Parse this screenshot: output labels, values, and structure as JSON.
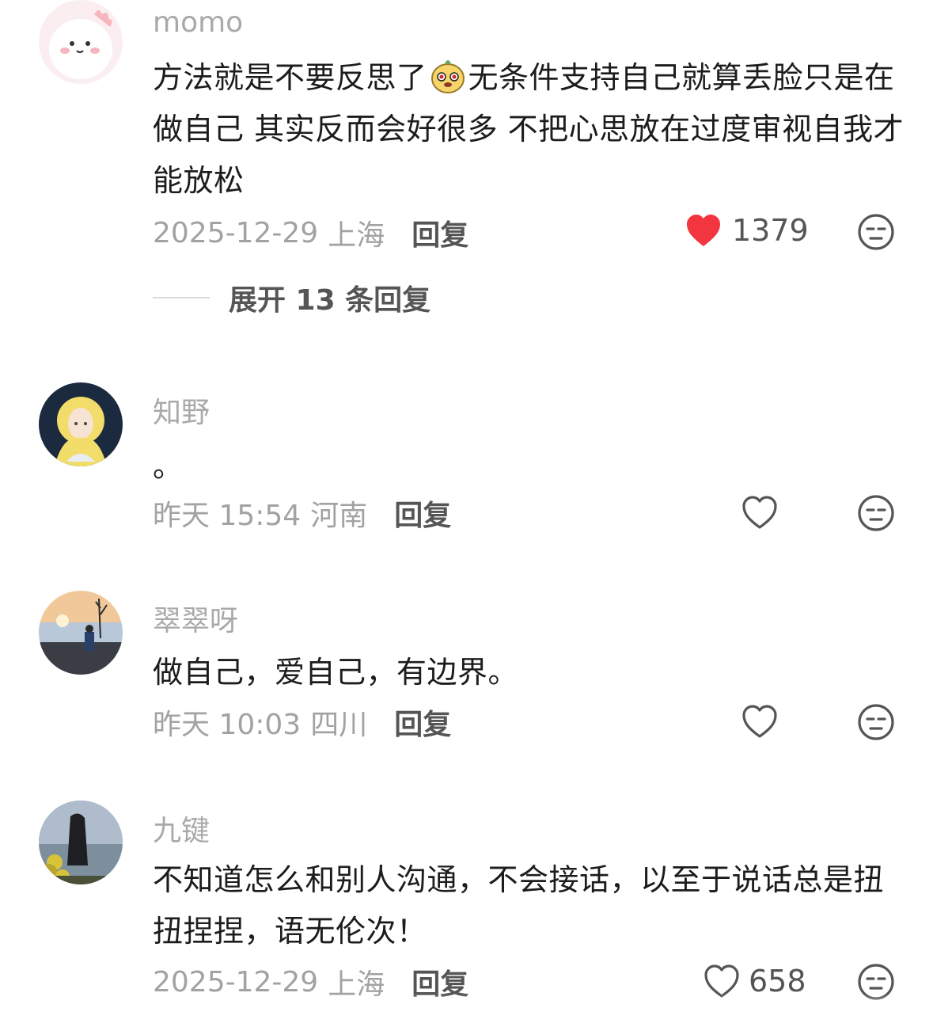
{
  "comments": [
    {
      "username": "momo",
      "text_before": "方法就是不要反思了",
      "emoji": "puppy-emoji",
      "text_after": "无条件支持自己就算丢脸只是在做自己 其实反而会好很多 不把心思放在过度审视自我才能放松",
      "date": "2025-12-29",
      "location": "上海",
      "reply_label": "回复",
      "likes": "1379",
      "liked": true,
      "expand_label": "展开 13 条回复"
    },
    {
      "username": "知野",
      "text": "。",
      "date": "昨天 15:54",
      "location": "河南",
      "reply_label": "回复"
    },
    {
      "username": "翠翠呀",
      "text": "做自己，爱自己，有边界。",
      "date": "昨天 10:03",
      "location": "四川",
      "reply_label": "回复"
    },
    {
      "username": "九键",
      "text": "不知道怎么和别人沟通，不会接话，以至于说话总是扭扭捏捏，语无伦次！",
      "date": "2025-12-29",
      "location": "上海",
      "reply_label": "回复",
      "likes": "658"
    }
  ],
  "colors": {
    "liked_heart": "#f2353f",
    "muted_text": "#a2a2a2"
  },
  "icons": {
    "like": "heart-icon",
    "dislike": "dislike-face-icon"
  }
}
